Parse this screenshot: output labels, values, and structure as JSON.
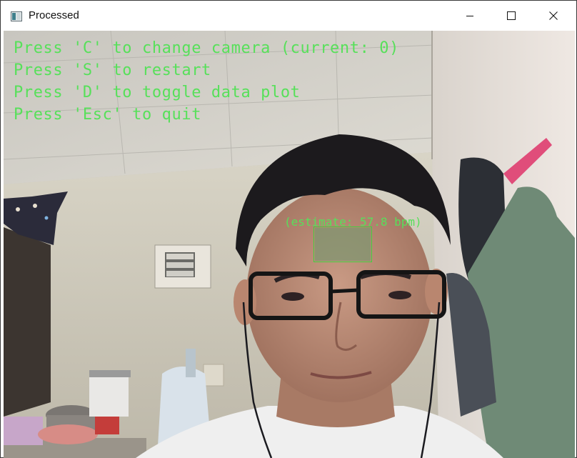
{
  "window": {
    "title": "Processed",
    "icon": "app-window-icon",
    "controls": [
      "minimize-icon",
      "maximize-icon",
      "close-icon"
    ]
  },
  "overlay": {
    "instructions": [
      "Press 'C' to change camera (current: 0)",
      "Press 'S' to restart",
      "Press 'D' to toggle data plot",
      "Press 'Esc' to quit"
    ],
    "estimate_label": "(estimate: 57.8 bpm)",
    "text_color": "#57e05a"
  },
  "camera_feed": {
    "content": "webcam frame: person wearing glasses in a room"
  }
}
